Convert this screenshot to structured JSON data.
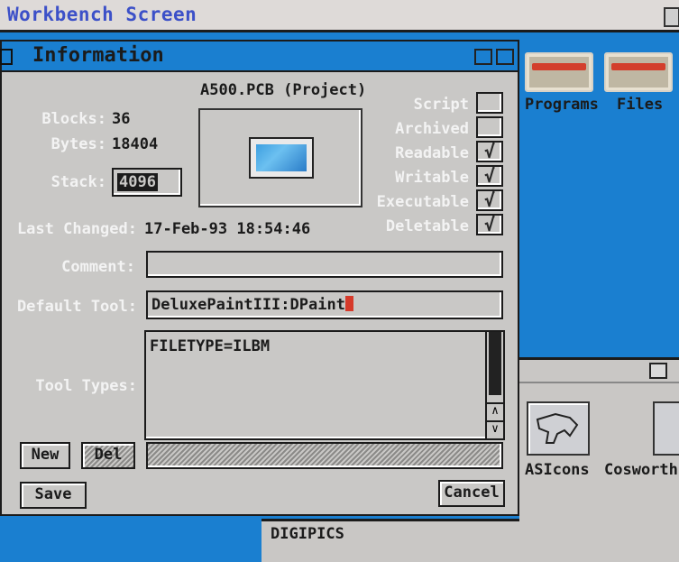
{
  "screen": {
    "title": "Workbench Screen"
  },
  "drawer": {
    "items": [
      {
        "label": "Programs"
      },
      {
        "label": "Files"
      }
    ]
  },
  "drawer2": {
    "items": [
      {
        "label": "ASIcons"
      },
      {
        "label": "Cosworth"
      }
    ]
  },
  "drawer3": {
    "title": "DIGIPICS"
  },
  "info": {
    "title": "Information",
    "project_name": "A500.PCB (Project)",
    "blocks_label": "Blocks:",
    "blocks_value": "36",
    "bytes_label": "Bytes:",
    "bytes_value": "18404",
    "stack_label": "Stack:",
    "stack_value": "4096",
    "last_changed_label": "Last Changed:",
    "last_changed_value": "17-Feb-93 18:54:46",
    "comment_label": "Comment:",
    "comment_value": "",
    "default_tool_label": "Default Tool:",
    "default_tool_value": "DeluxePaintIII:DPaint",
    "tool_types_label": "Tool Types:",
    "tool_types_lines": [
      "FILETYPE=ILBM"
    ],
    "protection": [
      {
        "label": "Script",
        "checked": false
      },
      {
        "label": "Archived",
        "checked": false
      },
      {
        "label": "Readable",
        "checked": true
      },
      {
        "label": "Writable",
        "checked": true
      },
      {
        "label": "Executable",
        "checked": true
      },
      {
        "label": "Deletable",
        "checked": true
      }
    ],
    "check_glyph": "√",
    "new_button": "New",
    "del_button": "Del",
    "save_button": "Save",
    "cancel_button": "Cancel"
  },
  "colors": {
    "workbench_blue": "#1a7fd0",
    "panel_gray": "#c9c8c6",
    "title_blue_text": "#3c50c8",
    "cursor_red": "#d63a2a"
  }
}
